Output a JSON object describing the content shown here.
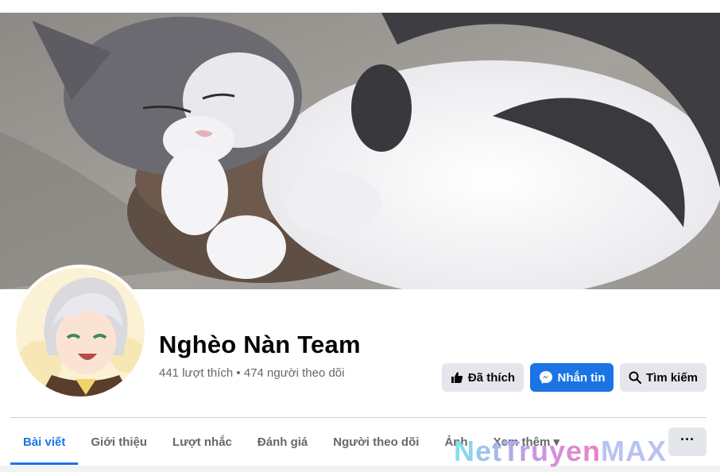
{
  "page": {
    "name": "Nghèo Nàn Team",
    "stats": "441 lượt thích • 474 người theo dõi"
  },
  "actions": {
    "liked_label": "Đã thích",
    "message_label": "Nhắn tin",
    "search_label": "Tìm kiếm"
  },
  "tabs": [
    {
      "label": "Bài viết",
      "active": true
    },
    {
      "label": "Giới thiệu"
    },
    {
      "label": "Lượt nhắc"
    },
    {
      "label": "Đánh giá"
    },
    {
      "label": "Người theo dõi"
    },
    {
      "label": "Ảnh"
    },
    {
      "label": "Xem thêm ▾"
    }
  ],
  "more_label": "···",
  "watermark": {
    "part1": "NetTruyen",
    "part2": "MAX"
  },
  "icons": {
    "like": "thumbs-up-icon",
    "message": "messenger-icon",
    "search": "search-icon"
  },
  "colors": {
    "accent": "#1b74e4",
    "button_bg": "#e4e6eb",
    "muted_text": "#65676b"
  }
}
